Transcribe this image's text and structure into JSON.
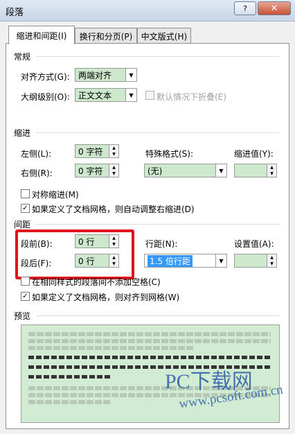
{
  "window": {
    "title": "段落",
    "help": "?",
    "close": "✕"
  },
  "tabs": [
    {
      "label": "缩进和间距(I)"
    },
    {
      "label": "换行和分页(P)"
    },
    {
      "label": "中文版式(H)"
    }
  ],
  "general": {
    "section_title": "常规",
    "align_label": "对齐方式(G):",
    "align_value": "两端对齐",
    "outline_label": "大纲级别(O):",
    "outline_value": "正文文本",
    "collapse_label": "默认情况下折叠(E)"
  },
  "indent": {
    "section_title": "缩进",
    "left_label": "左侧(L):",
    "left_value": "0 字符",
    "right_label": "右侧(R):",
    "right_value": "0 字符",
    "special_label": "特殊格式(S):",
    "special_value": "(无)",
    "amount_label": "缩进值(Y):",
    "mirror_label": "对称缩进(M)",
    "grid_label": "如果定义了文档网格，则自动调整右缩进(D)"
  },
  "spacing": {
    "section_title": "间距",
    "before_label": "段前(B):",
    "before_value": "0 行",
    "after_label": "段后(F):",
    "after_value": "0 行",
    "line_label": "行距(N):",
    "line_value": "1.5 倍行距",
    "at_label": "设置值(A):",
    "nospace_label": "在相同样式的段落间不添加空格(C)",
    "snap_label": "如果定义了文档网格，则对齐到网格(W)"
  },
  "preview": {
    "section_title": "预览"
  },
  "watermark": {
    "brand": "PC下载网",
    "url": "www.pcsoft.com.cn"
  }
}
